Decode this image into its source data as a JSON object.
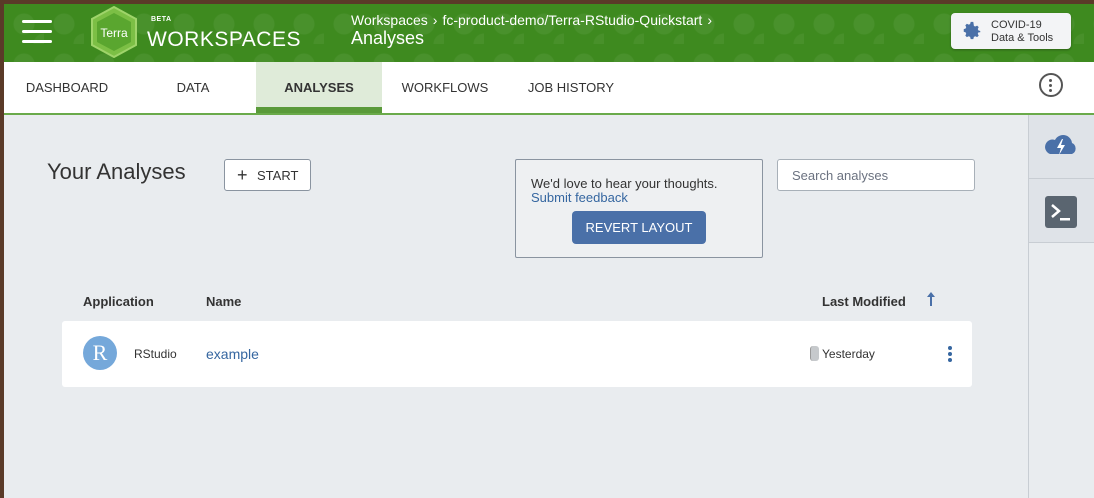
{
  "header": {
    "logo_text": "Terra",
    "beta": "BETA",
    "brand": "WORKSPACES",
    "breadcrumbs": [
      "Workspaces",
      "fc-product-demo/Terra-RStudio-Quickstart"
    ],
    "separator": "›",
    "page_title": "Analyses",
    "covid_line1": "COVID-19",
    "covid_line2": "Data & Tools"
  },
  "tabs": [
    {
      "label": "DASHBOARD"
    },
    {
      "label": "DATA"
    },
    {
      "label": "ANALYSES"
    },
    {
      "label": "WORKFLOWS"
    },
    {
      "label": "JOB HISTORY"
    }
  ],
  "main": {
    "title": "Your Analyses",
    "start_plus": "+",
    "start_label": "START",
    "feedback_text": "We'd love to hear your thoughts.",
    "feedback_link": "Submit feedback",
    "revert_label": "REVERT LAYOUT",
    "search_placeholder": "Search analyses"
  },
  "table": {
    "columns": [
      "Application",
      "Name",
      "Last Modified"
    ],
    "rows": [
      {
        "avatar": "R",
        "application": "RStudio",
        "name": "example",
        "modified": "Yesterday"
      }
    ]
  },
  "colors": {
    "header_green": "#3e8a1f",
    "active_tab": "#dfebd9",
    "primary_blue": "#4a70a8",
    "link_blue": "#3566a0"
  },
  "icons": [
    "menu-icon",
    "terra-logo",
    "gear-icon",
    "kebab-icon",
    "cloud-lightning-icon",
    "terminal-icon",
    "plus-icon",
    "sort-up-icon"
  ]
}
